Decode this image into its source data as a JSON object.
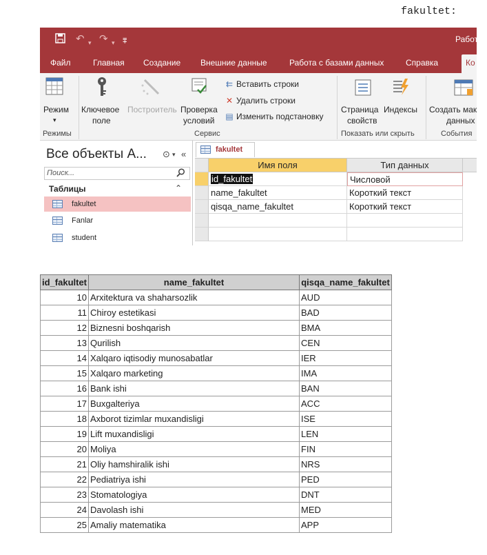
{
  "page_title": "fakultet:",
  "window": {
    "qat_extra": "Работ",
    "tabs": [
      "Файл",
      "Главная",
      "Создание",
      "Внешние данные",
      "Работа с базами данных",
      "Справка",
      "Ко"
    ]
  },
  "ribbon": {
    "mode_label": "Режим",
    "key_label": "Ключевое",
    "key_label2": "поле",
    "builder_label": "Построитель",
    "check_label": "Проверка",
    "check_label2": "условий",
    "insert_rows": "Вставить строки",
    "delete_rows": "Удалить строки",
    "change_lookup": "Изменить подстановку",
    "props_label": "Страница",
    "props_label2": "свойств",
    "indexes_label": "Индексы",
    "create_macro": "Создать мак",
    "create_macro2": "данных",
    "groups": {
      "modes": "Режимы",
      "service": "Сервис",
      "show_hide": "Показать или скрыть",
      "events": "События"
    }
  },
  "nav": {
    "title": "Все объекты A...",
    "search_placeholder": "Поиск...",
    "section": "Таблицы",
    "items": [
      "fakultet",
      "Fanlar",
      "student"
    ]
  },
  "design": {
    "tab_label": "fakultet",
    "col_field": "Имя поля",
    "col_type": "Тип данных",
    "rows": [
      {
        "field": "id_fakultet",
        "type": "Числовой"
      },
      {
        "field": "name_fakultet",
        "type": "Короткий текст"
      },
      {
        "field": "qisqa_name_fakultet",
        "type": "Короткий текст"
      }
    ]
  },
  "table": {
    "headers": [
      "id_fakultet",
      "name_fakultet",
      "qisqa_name_fakultet"
    ],
    "rows": [
      [
        "10",
        "Arxitektura va shaharsozlik",
        "AUD"
      ],
      [
        "11",
        "Chiroy estetikasi",
        "BAD"
      ],
      [
        "12",
        "Biznesni boshqarish",
        "BMA"
      ],
      [
        "13",
        "Qurilish",
        "CEN"
      ],
      [
        "14",
        "Xalqaro iqtisodiy munosabatlar",
        "IER"
      ],
      [
        "15",
        "Xalqaro marketing",
        "IMA"
      ],
      [
        "16",
        "Bank ishi",
        "BAN"
      ],
      [
        "17",
        "Buxgalteriya",
        "ACC"
      ],
      [
        "18",
        "Axborot tizimlar muxandisligi",
        "ISE"
      ],
      [
        "19",
        "Lift muxandisligi",
        "LEN"
      ],
      [
        "20",
        "Moliya",
        "FIN"
      ],
      [
        "21",
        "Oliy hamshiralik ishi",
        "NRS"
      ],
      [
        "22",
        "Pediatriya ishi",
        "PED"
      ],
      [
        "23",
        "Stomatologiya",
        "DNT"
      ],
      [
        "24",
        "Davolash ishi",
        "MED"
      ],
      [
        "25",
        "Amaliy matematika",
        "APP"
      ]
    ]
  }
}
